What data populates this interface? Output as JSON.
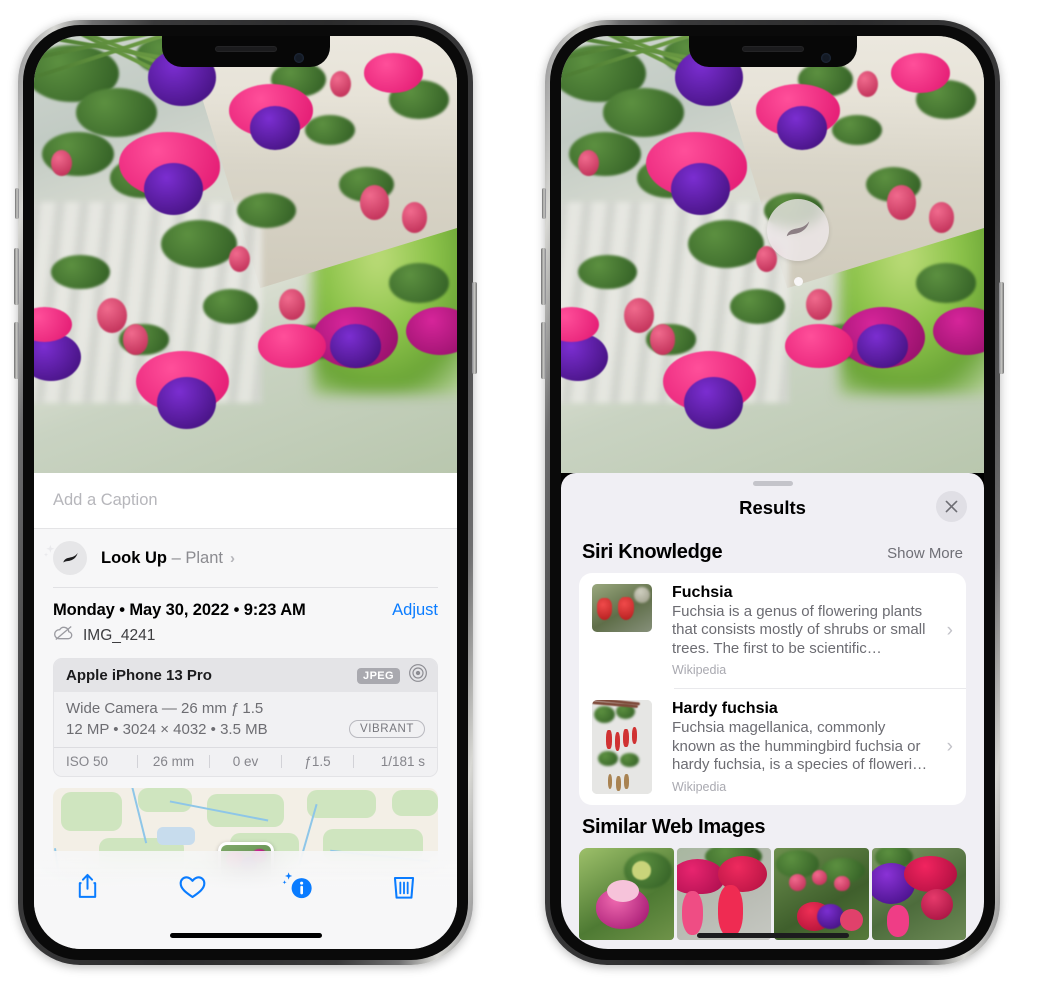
{
  "left_phone": {
    "photo": {
      "alt": "fuchsia-plant-photo"
    },
    "caption": {
      "placeholder": "Add a Caption",
      "value": ""
    },
    "look_up": {
      "icon": "leaf-icon",
      "label": "Look Up",
      "dash": " – ",
      "subject": "Plant",
      "chevron": "›"
    },
    "datetime": "Monday • May 30, 2022 • 9:23 AM",
    "adjust_label": "Adjust",
    "filename": "IMG_4241",
    "filename_icon": "cloud-slash-icon",
    "metadata": {
      "device": "Apple iPhone 13 Pro",
      "format_badge": "JPEG",
      "aperture_icon": "lens-icon",
      "lens": "Wide Camera — 26 mm ƒ 1.5",
      "specs": "12 MP • 3024 × 4032 • 3.5 MB",
      "style_pill": "VIBRANT",
      "exif": [
        "ISO 50",
        "26 mm",
        "0 ev",
        "ƒ1.5",
        "1/181 s"
      ]
    },
    "map": {
      "name": "photo-location-map",
      "pin": "photo-thumbnail-pin"
    },
    "toolbar": [
      {
        "name": "share-button",
        "icon": "share-icon"
      },
      {
        "name": "favorite-button",
        "icon": "heart-icon"
      },
      {
        "name": "info-button",
        "icon": "info-sparkle-icon"
      },
      {
        "name": "delete-button",
        "icon": "trash-icon"
      }
    ]
  },
  "right_phone": {
    "photo": {
      "alt": "fuchsia-plant-photo"
    },
    "vlu_badge": {
      "icon": "leaf-icon",
      "name": "visual-look-up-badge"
    },
    "sheet": {
      "title": "Results",
      "close_icon": "close-icon",
      "sections": [
        {
          "title": "Siri Knowledge",
          "action": "Show More",
          "items": [
            {
              "title": "Fuchsia",
              "description": "Fuchsia is a genus of flowering plants that consists mostly of shrubs or small trees. The first to be scientific…",
              "source": "Wikipedia",
              "thumb": "fuchsia-thumbnail",
              "chevron": "›"
            },
            {
              "title": "Hardy fuchsia",
              "description": "Fuchsia magellanica, commonly known as the hummingbird fuchsia or hardy fuchsia, is a species of floweri…",
              "source": "Wikipedia",
              "thumb": "hardy-fuchsia-thumbnail",
              "chevron": "›"
            }
          ]
        },
        {
          "title": "Similar Web Images",
          "tiles": [
            {
              "name": "web-image-1"
            },
            {
              "name": "web-image-2"
            },
            {
              "name": "web-image-3"
            },
            {
              "name": "web-image-4"
            }
          ]
        }
      ]
    }
  },
  "colors": {
    "accent_blue": "#0a7cff",
    "sheet_bg": "#f0eff4",
    "info_bg": "#f7f7f8",
    "card_bg": "#ffffff",
    "muted_text": "#6c6c72"
  }
}
